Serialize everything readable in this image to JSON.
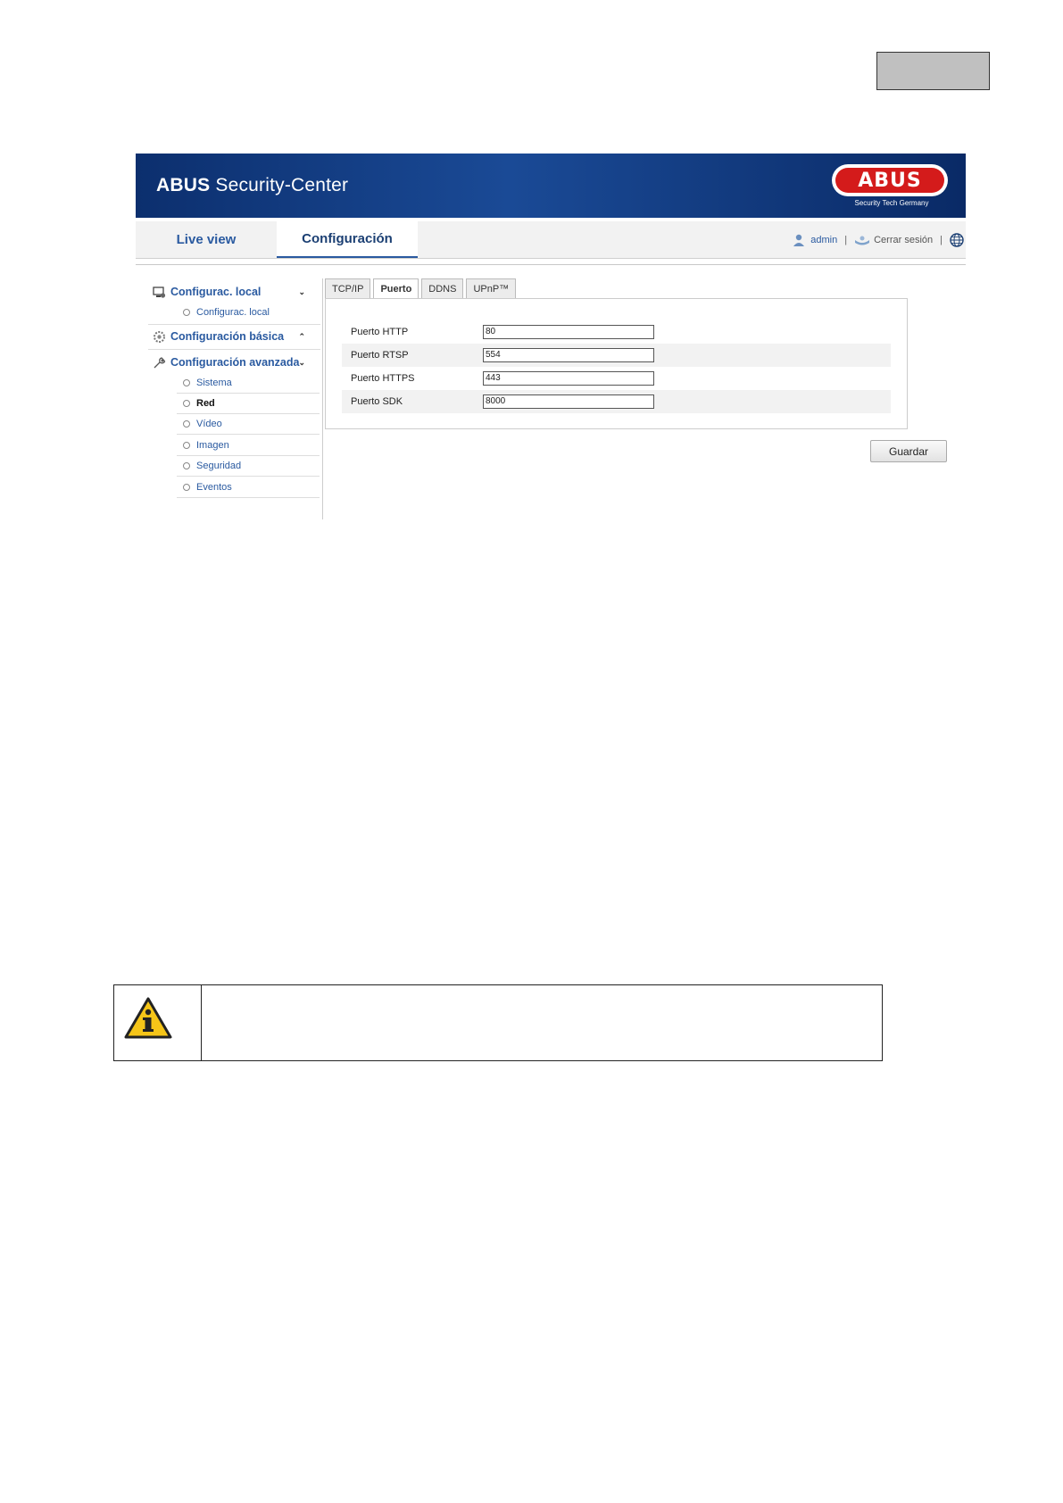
{
  "banner": {
    "brand": "ABUS",
    "title": "Security-Center",
    "logo_text": "ABUS",
    "logo_subtitle": "Security Tech Germany"
  },
  "nav": {
    "tabs": [
      {
        "label": "Live view"
      },
      {
        "label": "Configuración"
      }
    ],
    "user": "admin",
    "logout": "Cerrar sesión",
    "separator": "|"
  },
  "sidebar": {
    "sections": [
      {
        "label": "Configurac. local",
        "chevron": "⌄"
      },
      {
        "label": "Configuración básica",
        "chevron": "⌃"
      },
      {
        "label": "Configuración avanzada",
        "chevron": "⌄"
      }
    ],
    "items": [
      "Configurac. local",
      "Sistema",
      "Red",
      "Vídeo",
      "Imagen",
      "Seguridad",
      "Eventos"
    ]
  },
  "content": {
    "tabs": [
      "TCP/IP",
      "Puerto",
      "DDNS",
      "UPnP™"
    ],
    "fields": [
      {
        "label": "Puerto HTTP",
        "value": "80"
      },
      {
        "label": "Puerto RTSP",
        "value": "554"
      },
      {
        "label": "Puerto HTTPS",
        "value": "443"
      },
      {
        "label": "Puerto SDK",
        "value": "8000"
      }
    ],
    "save_label": "Guardar"
  },
  "colors": {
    "accent": "#2a5aa0",
    "banner": "#0c2f6e",
    "logo_red": "#d41b1b",
    "note_yellow": "#f5c518"
  }
}
